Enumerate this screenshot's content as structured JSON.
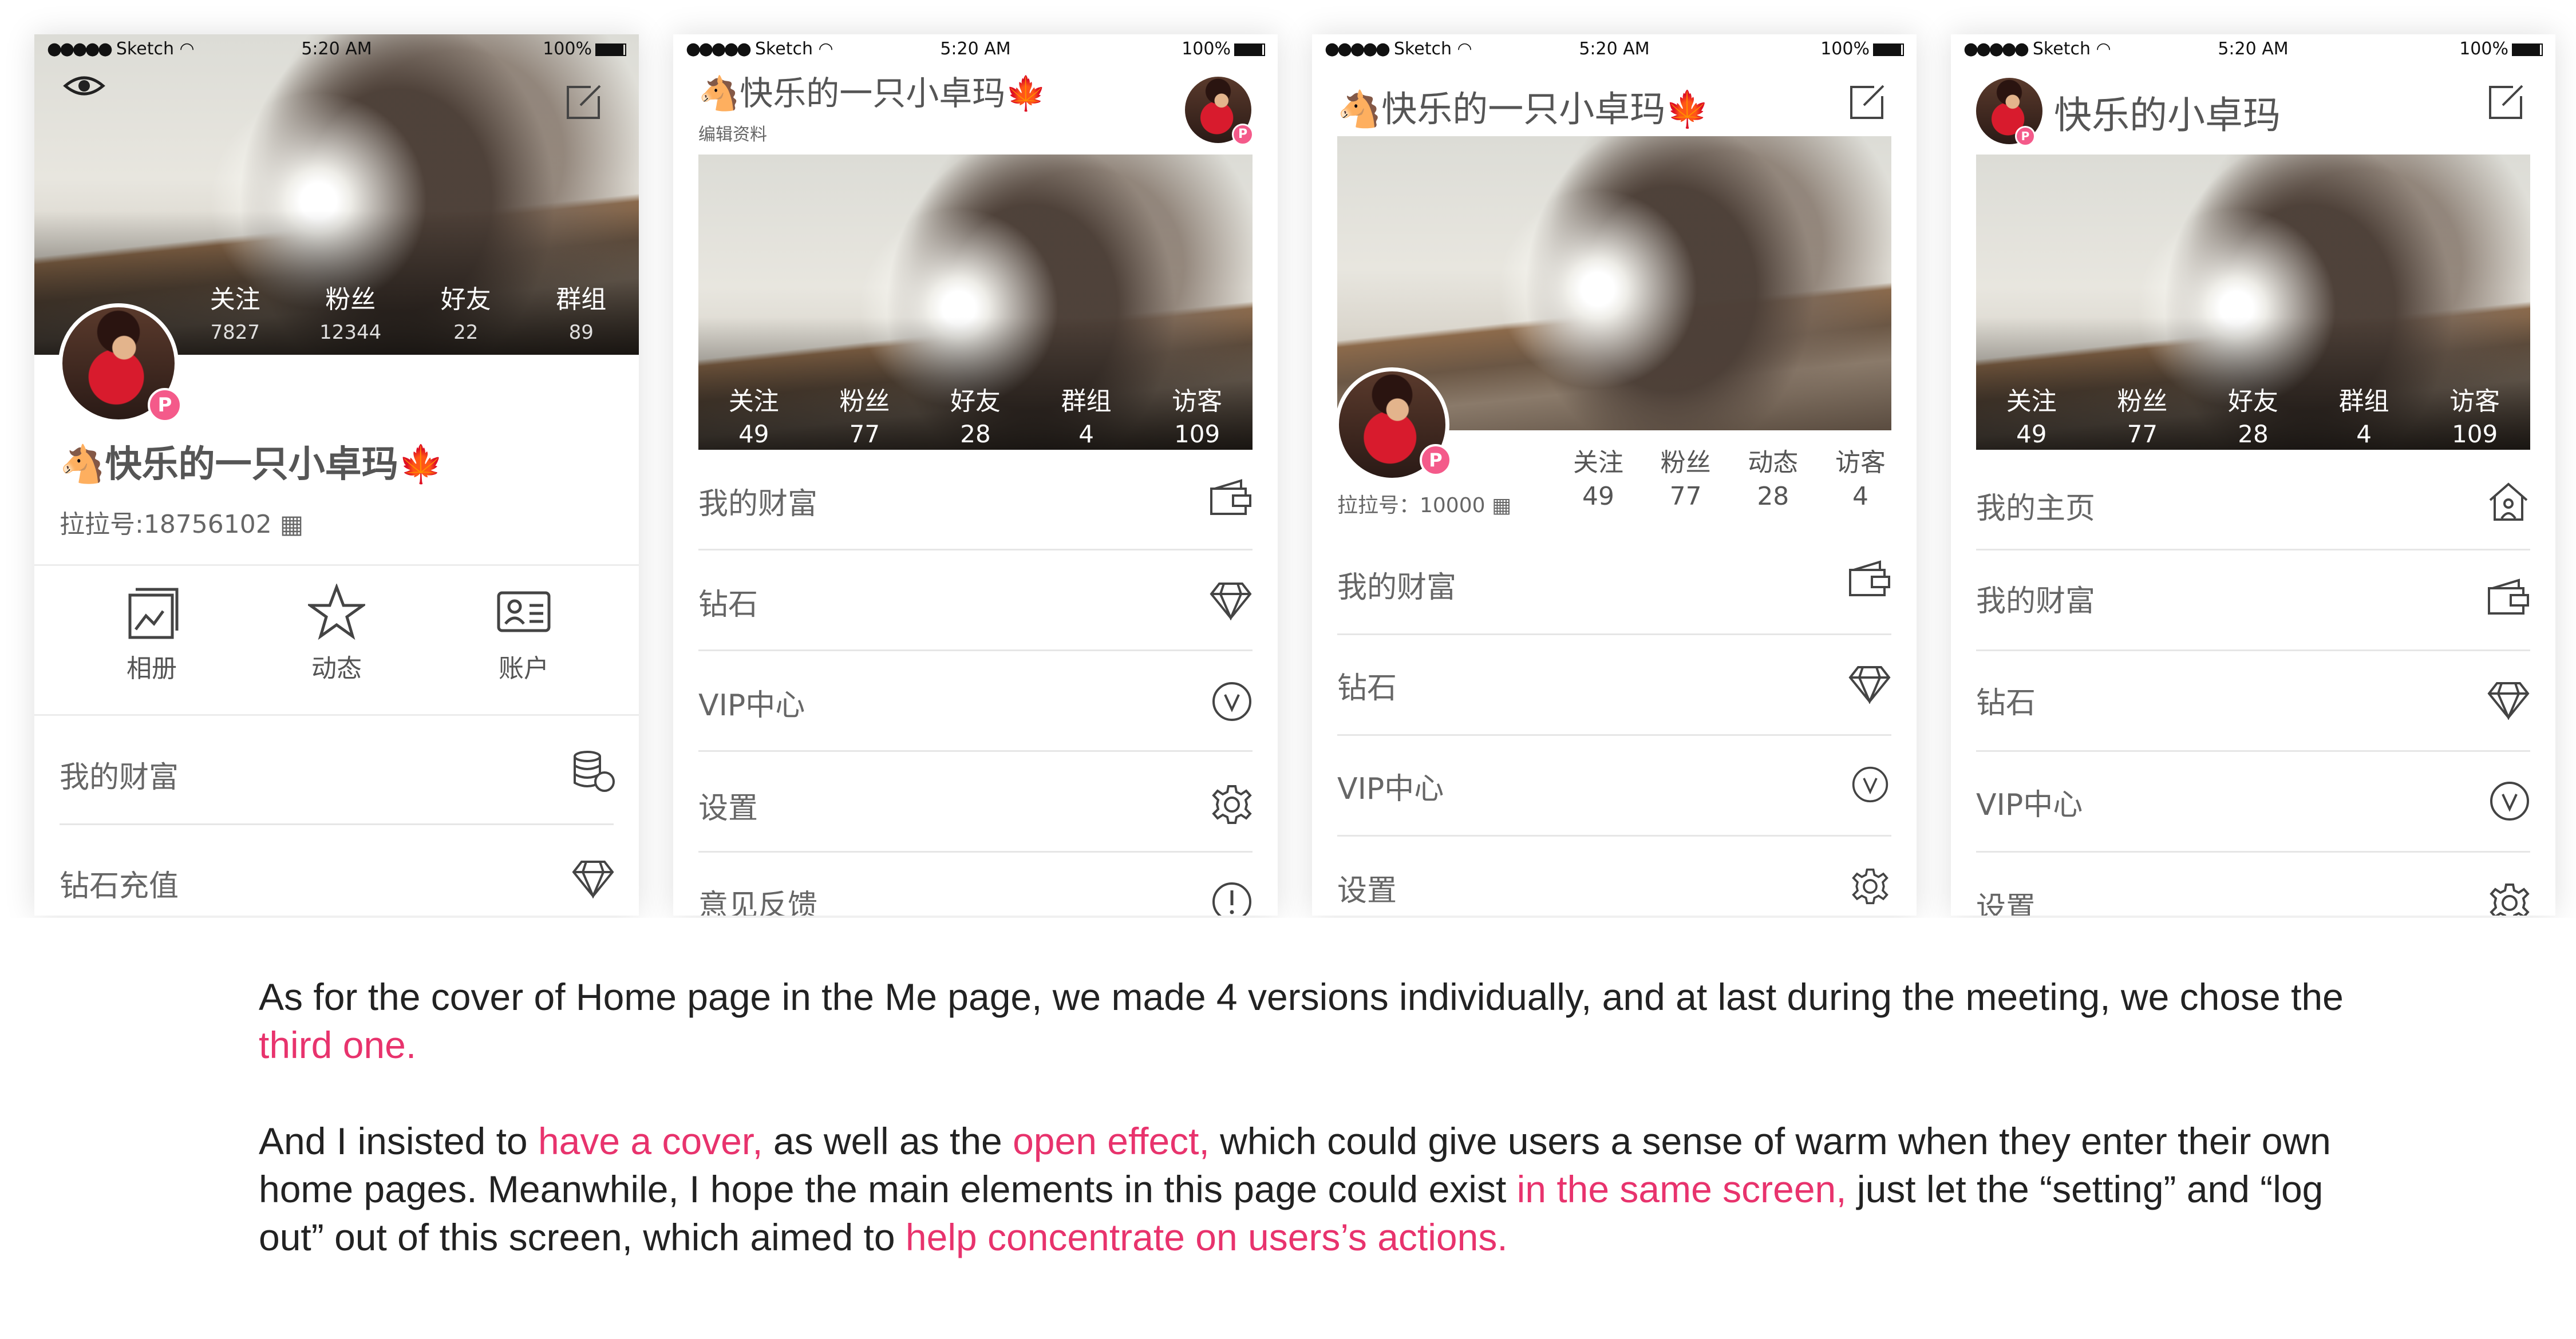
{
  "status_bar": {
    "carrier": "Sketch",
    "time": "5:20 AM",
    "battery": "100%"
  },
  "profile": {
    "name": "🐴快乐的一只小卓玛🍁",
    "name_short": "快乐的小卓玛",
    "id_label_1": "拉拉号:18756102",
    "id_label_3": "拉拉号：10000",
    "edit_profile": "编辑资料",
    "badge": "P"
  },
  "screen1": {
    "stats": [
      {
        "label": "关注",
        "value": "7827"
      },
      {
        "label": "粉丝",
        "value": "12344"
      },
      {
        "label": "好友",
        "value": "22"
      },
      {
        "label": "群组",
        "value": "89"
      }
    ],
    "actions": [
      {
        "label": "相册",
        "icon": "album-icon"
      },
      {
        "label": "动态",
        "icon": "star-icon"
      },
      {
        "label": "账户",
        "icon": "id-card-icon"
      }
    ],
    "menu": [
      {
        "label": "我的财富",
        "icon": "coins-icon"
      },
      {
        "label": "钻石充值",
        "icon": "diamond-icon"
      }
    ]
  },
  "screen2": {
    "stats": [
      {
        "label": "关注",
        "value": "49"
      },
      {
        "label": "粉丝",
        "value": "77"
      },
      {
        "label": "好友",
        "value": "28"
      },
      {
        "label": "群组",
        "value": "4"
      },
      {
        "label": "访客",
        "value": "109"
      }
    ],
    "menu": [
      {
        "label": "我的财富",
        "icon": "wallet-icon"
      },
      {
        "label": "钻石",
        "icon": "diamond-icon"
      },
      {
        "label": "VIP中心",
        "icon": "vip-icon"
      },
      {
        "label": "设置",
        "icon": "gear-icon"
      },
      {
        "label": "意见反馈",
        "icon": "feedback-icon"
      }
    ]
  },
  "screen3": {
    "stats": [
      {
        "label": "关注",
        "value": "49"
      },
      {
        "label": "粉丝",
        "value": "77"
      },
      {
        "label": "动态",
        "value": "28"
      },
      {
        "label": "访客",
        "value": "4"
      }
    ],
    "menu": [
      {
        "label": "我的财富",
        "icon": "wallet-icon"
      },
      {
        "label": "钻石",
        "icon": "diamond-icon"
      },
      {
        "label": "VIP中心",
        "icon": "vip-icon"
      },
      {
        "label": "设置",
        "icon": "gear-icon"
      }
    ]
  },
  "screen4": {
    "stats": [
      {
        "label": "关注",
        "value": "49"
      },
      {
        "label": "粉丝",
        "value": "77"
      },
      {
        "label": "好友",
        "value": "28"
      },
      {
        "label": "群组",
        "value": "4"
      },
      {
        "label": "访客",
        "value": "109"
      }
    ],
    "menu": [
      {
        "label": "我的主页",
        "icon": "home-icon"
      },
      {
        "label": "我的财富",
        "icon": "wallet-icon"
      },
      {
        "label": "钻石",
        "icon": "diamond-icon"
      },
      {
        "label": "VIP中心",
        "icon": "vip-icon"
      },
      {
        "label": "设置",
        "icon": "gear-icon"
      }
    ]
  },
  "description": {
    "p1_a": "As for the cover of Home page in the Me page, we made 4 versions individually, and at last during the meeting, we chose the ",
    "p1_hl": "third one.",
    "p2_a": "And I insisted to ",
    "p2_hl1": "have a cover,",
    "p2_b": " as well as the ",
    "p2_hl2": "open effect,",
    "p2_c": " which could give users a sense of warm when they enter their own home pages. Meanwhile, I hope the main elements in this page could exist ",
    "p2_hl3": "in the same screen,",
    "p2_d": " just let the “setting” and “log out” out of this screen, which aimed to ",
    "p2_hl4": "help concentrate on users’s actions."
  },
  "colors": {
    "accent": "#e8336d",
    "badge": "#f45a8a"
  }
}
